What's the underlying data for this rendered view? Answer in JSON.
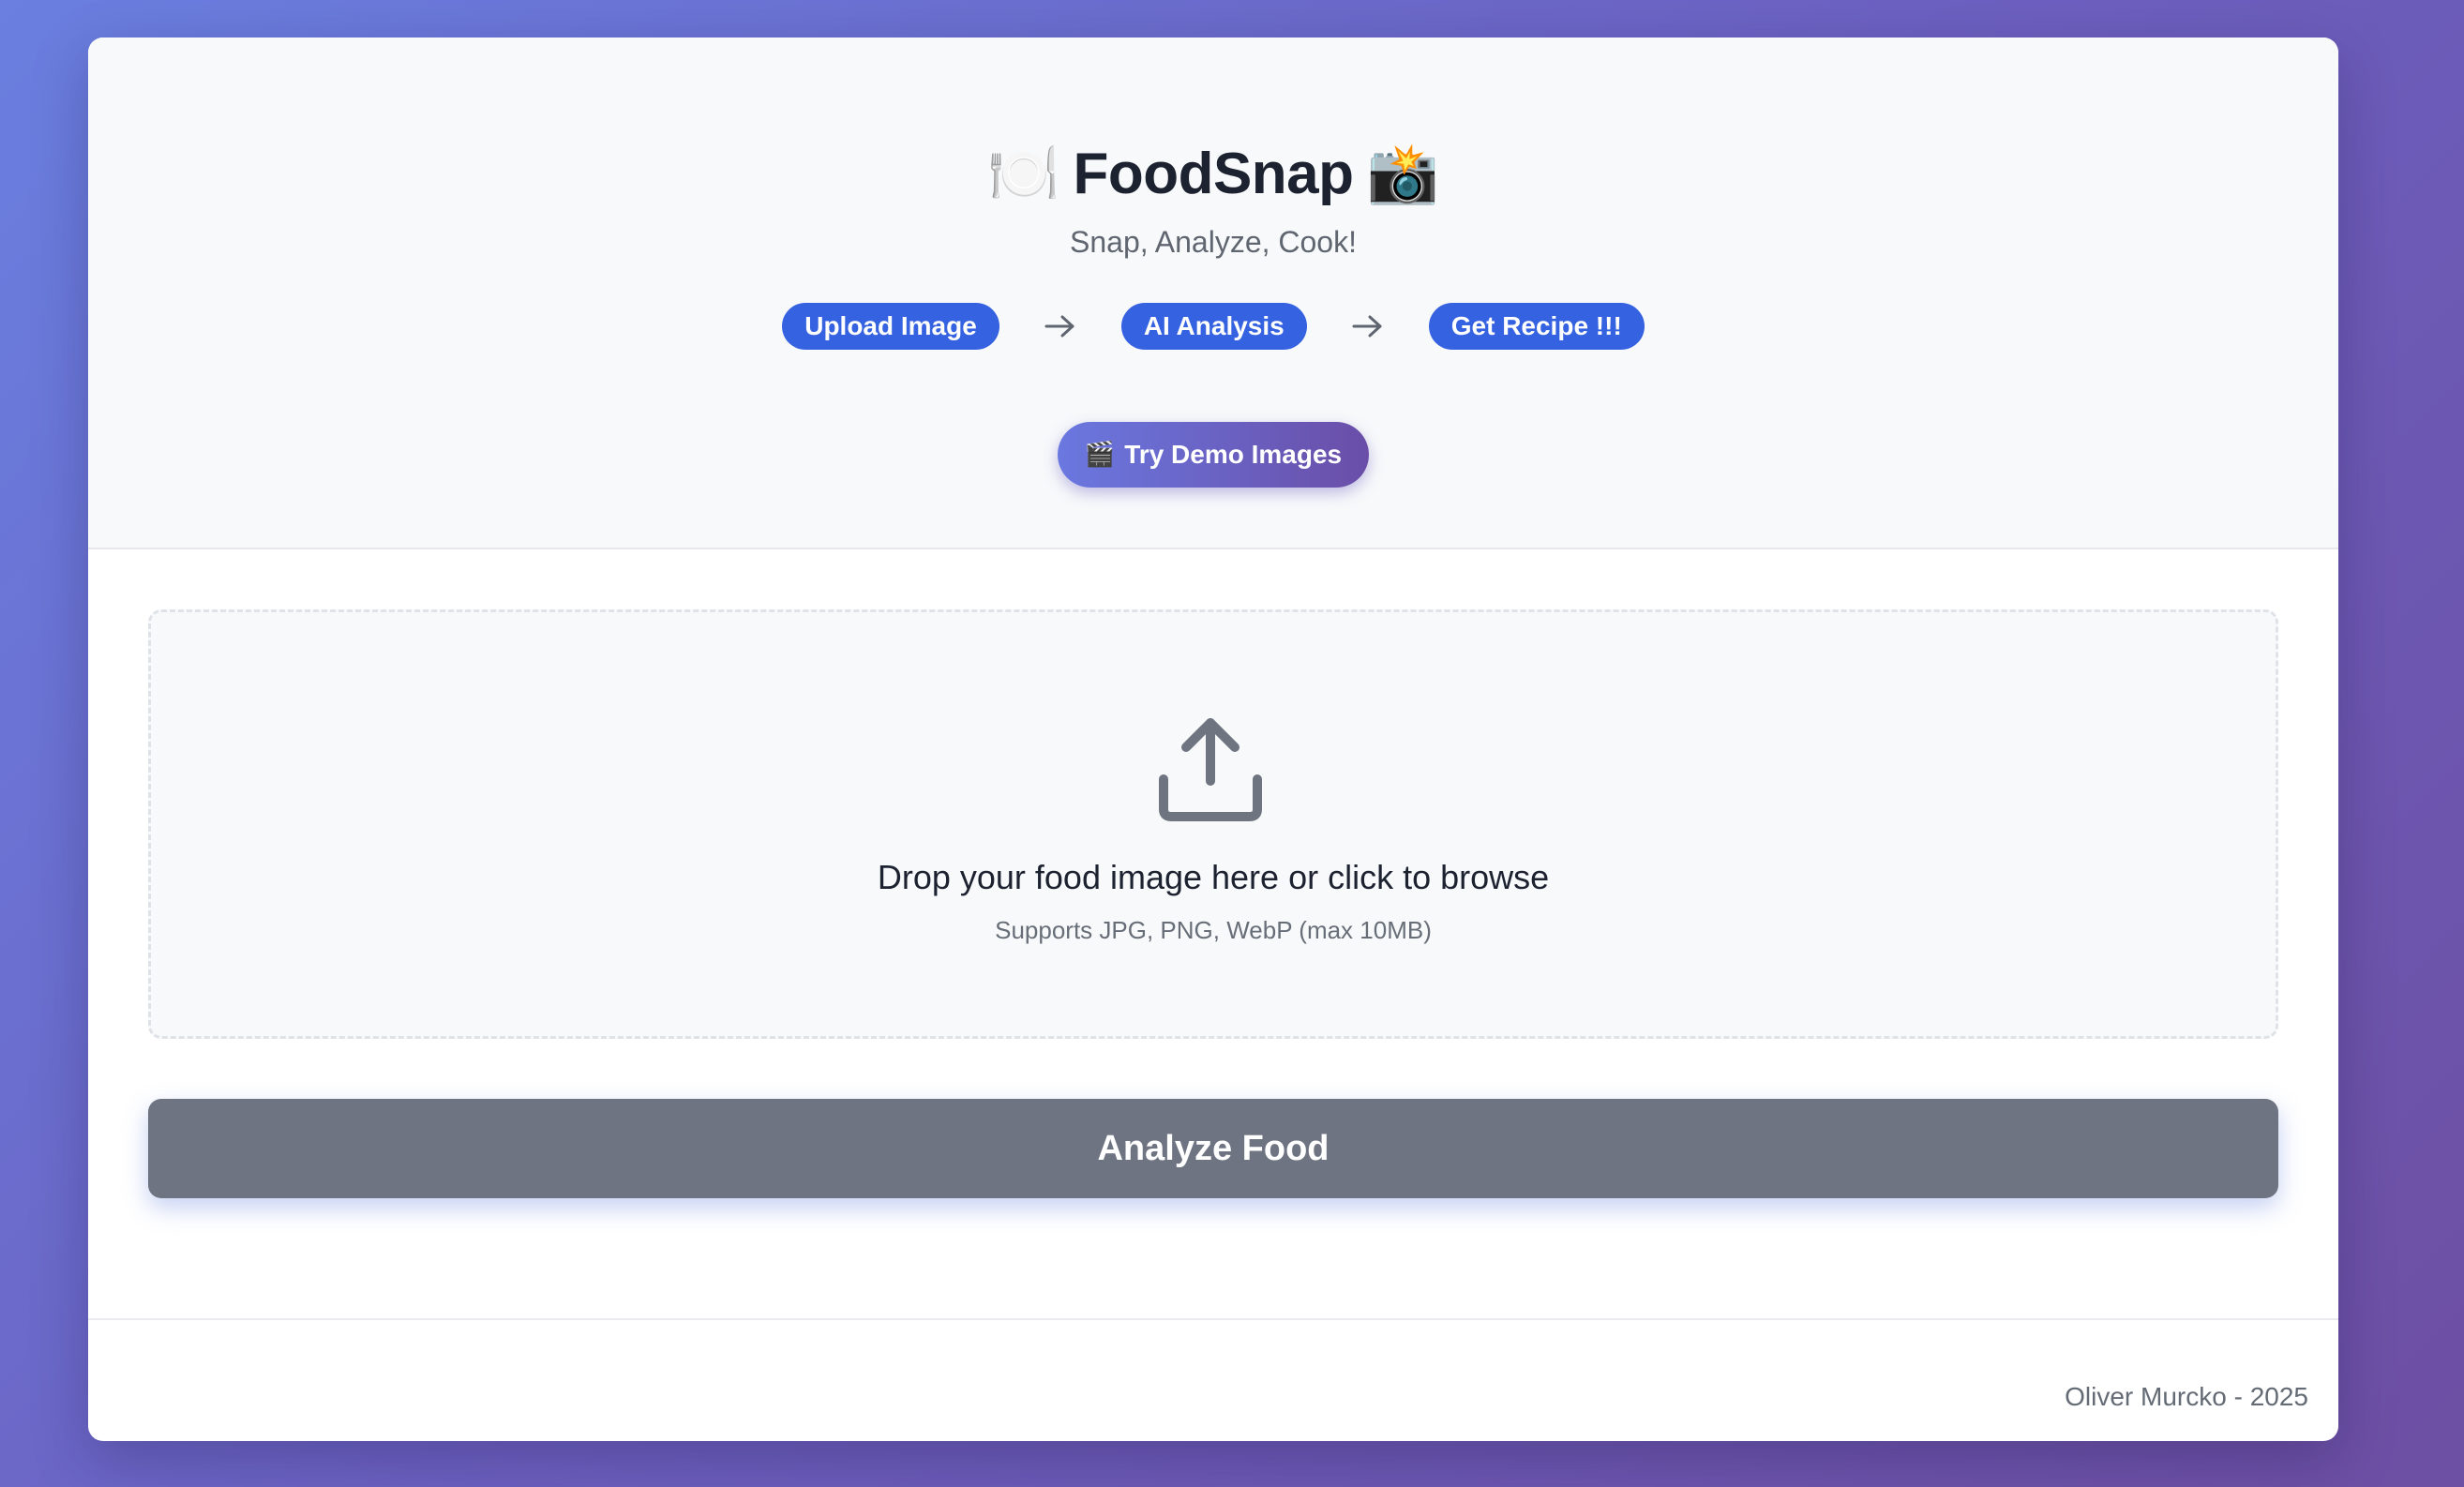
{
  "app": {
    "title_emoji_left": "🍽️",
    "title": "FoodSnap",
    "title_emoji_right": "📸",
    "subtitle": "Snap, Analyze, Cook!"
  },
  "steps": [
    {
      "label": "Upload Image"
    },
    {
      "label": "AI Analysis"
    },
    {
      "label": "Get Recipe !!!"
    }
  ],
  "step_arrow_icon": "arrow-right-icon",
  "demo_button": {
    "icon": "🎬",
    "label": "Try Demo Images"
  },
  "dropzone": {
    "icon": "upload-icon",
    "text": "Drop your food image here or click to browse",
    "hint": "Supports JPG, PNG, WebP (max 10MB)"
  },
  "analyze_button": {
    "label": "Analyze Food"
  },
  "footer": {
    "credit": "Oliver Murcko - 2025"
  },
  "colors": {
    "accent": "#3562e0",
    "analyze_button": "#6e7482",
    "background_start": "#6a7fe0",
    "background_end": "#6d4fa3"
  }
}
